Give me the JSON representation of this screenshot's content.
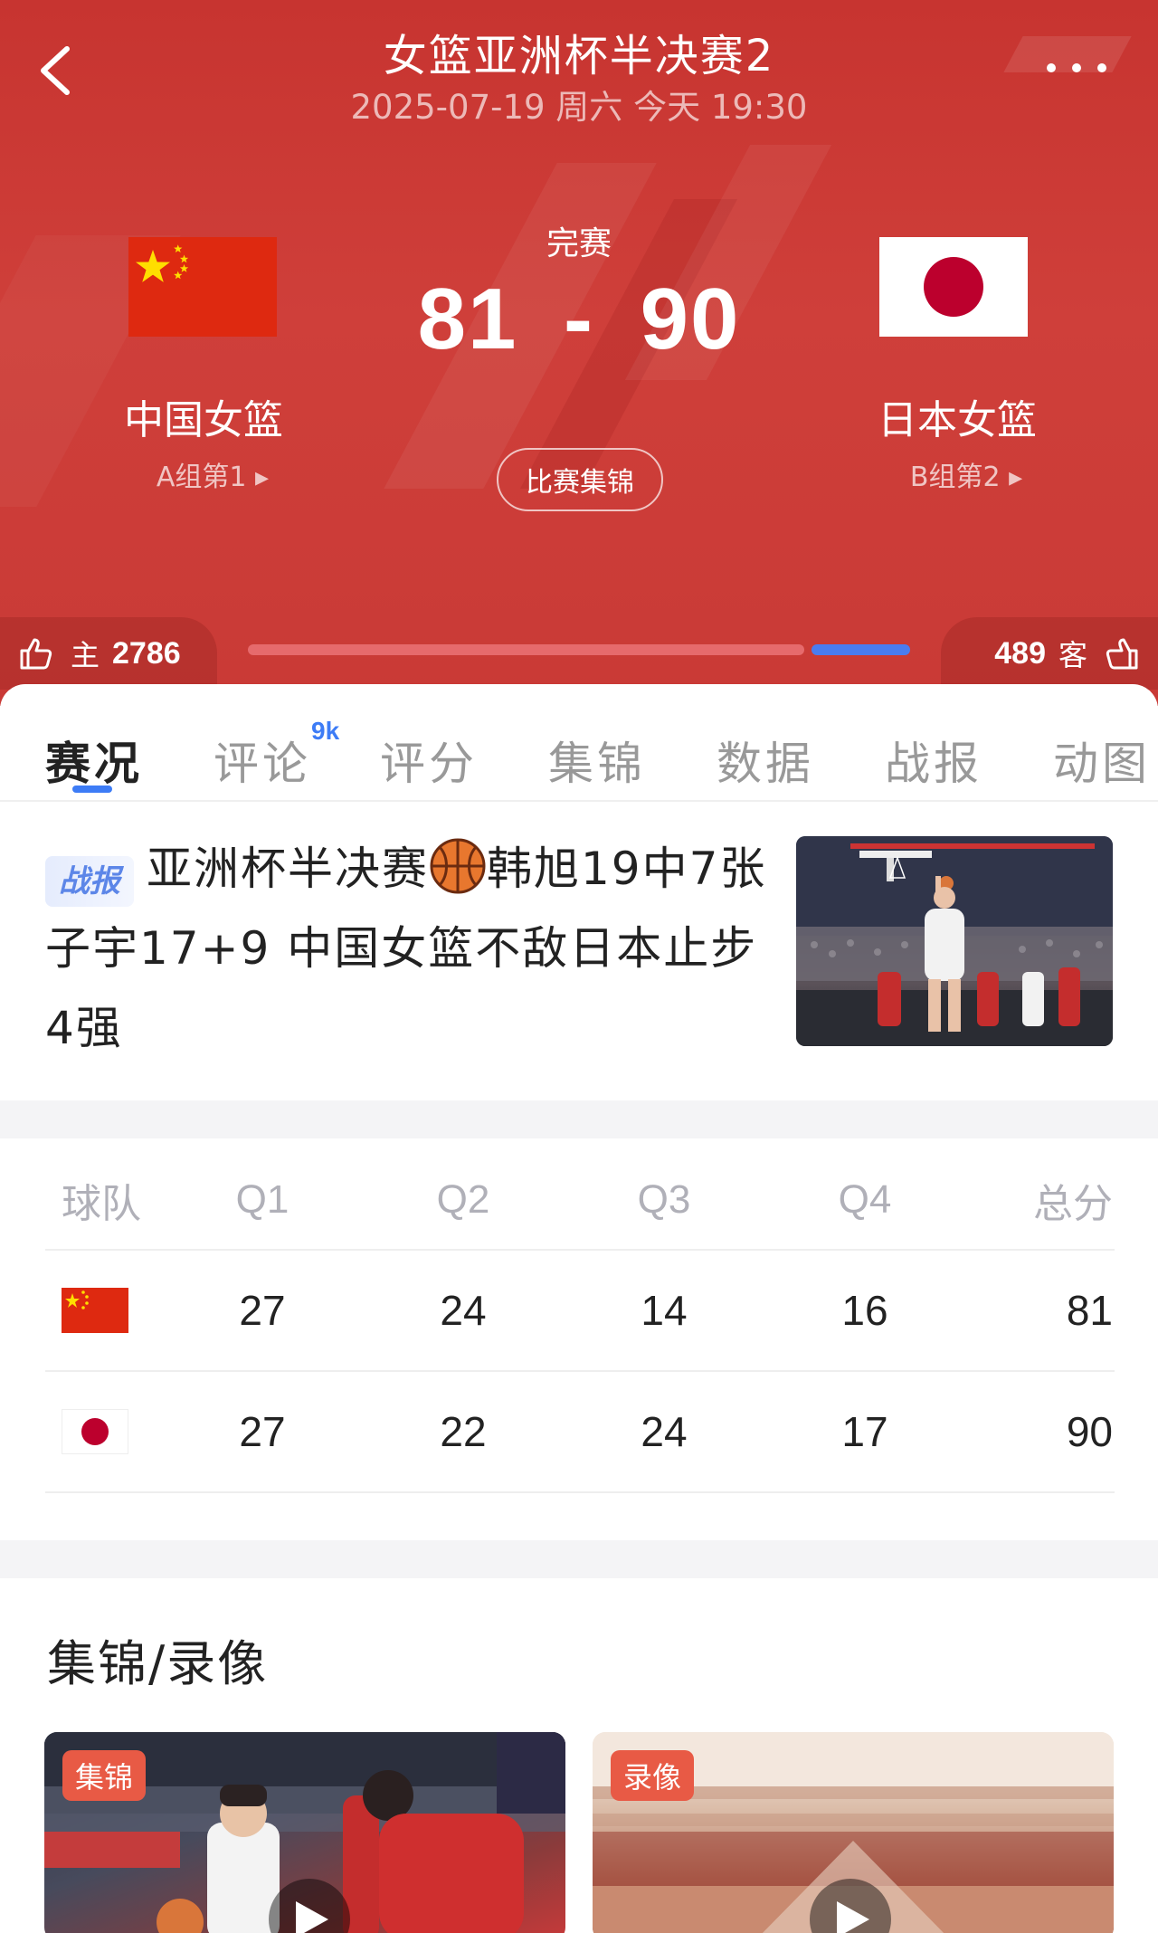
{
  "header": {
    "title": "女篮亚洲杯半决赛2",
    "datetime": "2025-07-19 周六 今天 19:30",
    "status": "完赛",
    "score_home": "81",
    "score_sep": "-",
    "score_away": "90",
    "highlights_button": "比赛集锦",
    "home": {
      "name": "中国女篮",
      "rank": "A组第1 ▸"
    },
    "away": {
      "name": "日本女篮",
      "rank": "B组第2 ▸"
    }
  },
  "votes": {
    "home_label": "主",
    "home_count": "2786",
    "away_label": "客",
    "away_count": "489",
    "home_fraction": 0.85,
    "away_fraction": 0.15
  },
  "tabs": [
    {
      "label": "赛况",
      "active": true
    },
    {
      "label": "评论",
      "badge": "9k"
    },
    {
      "label": "评分"
    },
    {
      "label": "集锦"
    },
    {
      "label": "数据"
    },
    {
      "label": "战报"
    },
    {
      "label": "动图"
    }
  ],
  "news": {
    "badge": "战报",
    "text_before": "亚洲杯半决赛",
    "text_after": "韩旭19中7张子宇17+9 中国女篮不敌日本止步4强"
  },
  "score_table": {
    "headers": [
      "球队",
      "Q1",
      "Q2",
      "Q3",
      "Q4",
      "总分"
    ],
    "rows": [
      {
        "team_flag": "china-flag-icon",
        "q": [
          "27",
          "24",
          "14",
          "16"
        ],
        "total": "81"
      },
      {
        "team_flag": "japan-flag-icon",
        "q": [
          "27",
          "22",
          "24",
          "17"
        ],
        "total": "90"
      }
    ]
  },
  "highlights": {
    "title": "集锦/录像",
    "videos": [
      {
        "tag": "集锦"
      },
      {
        "tag": "录像"
      }
    ]
  },
  "colors": {
    "header_red": "#cf3f3a",
    "accent_blue": "#3d7cf6",
    "tag_red": "#e85a45"
  }
}
